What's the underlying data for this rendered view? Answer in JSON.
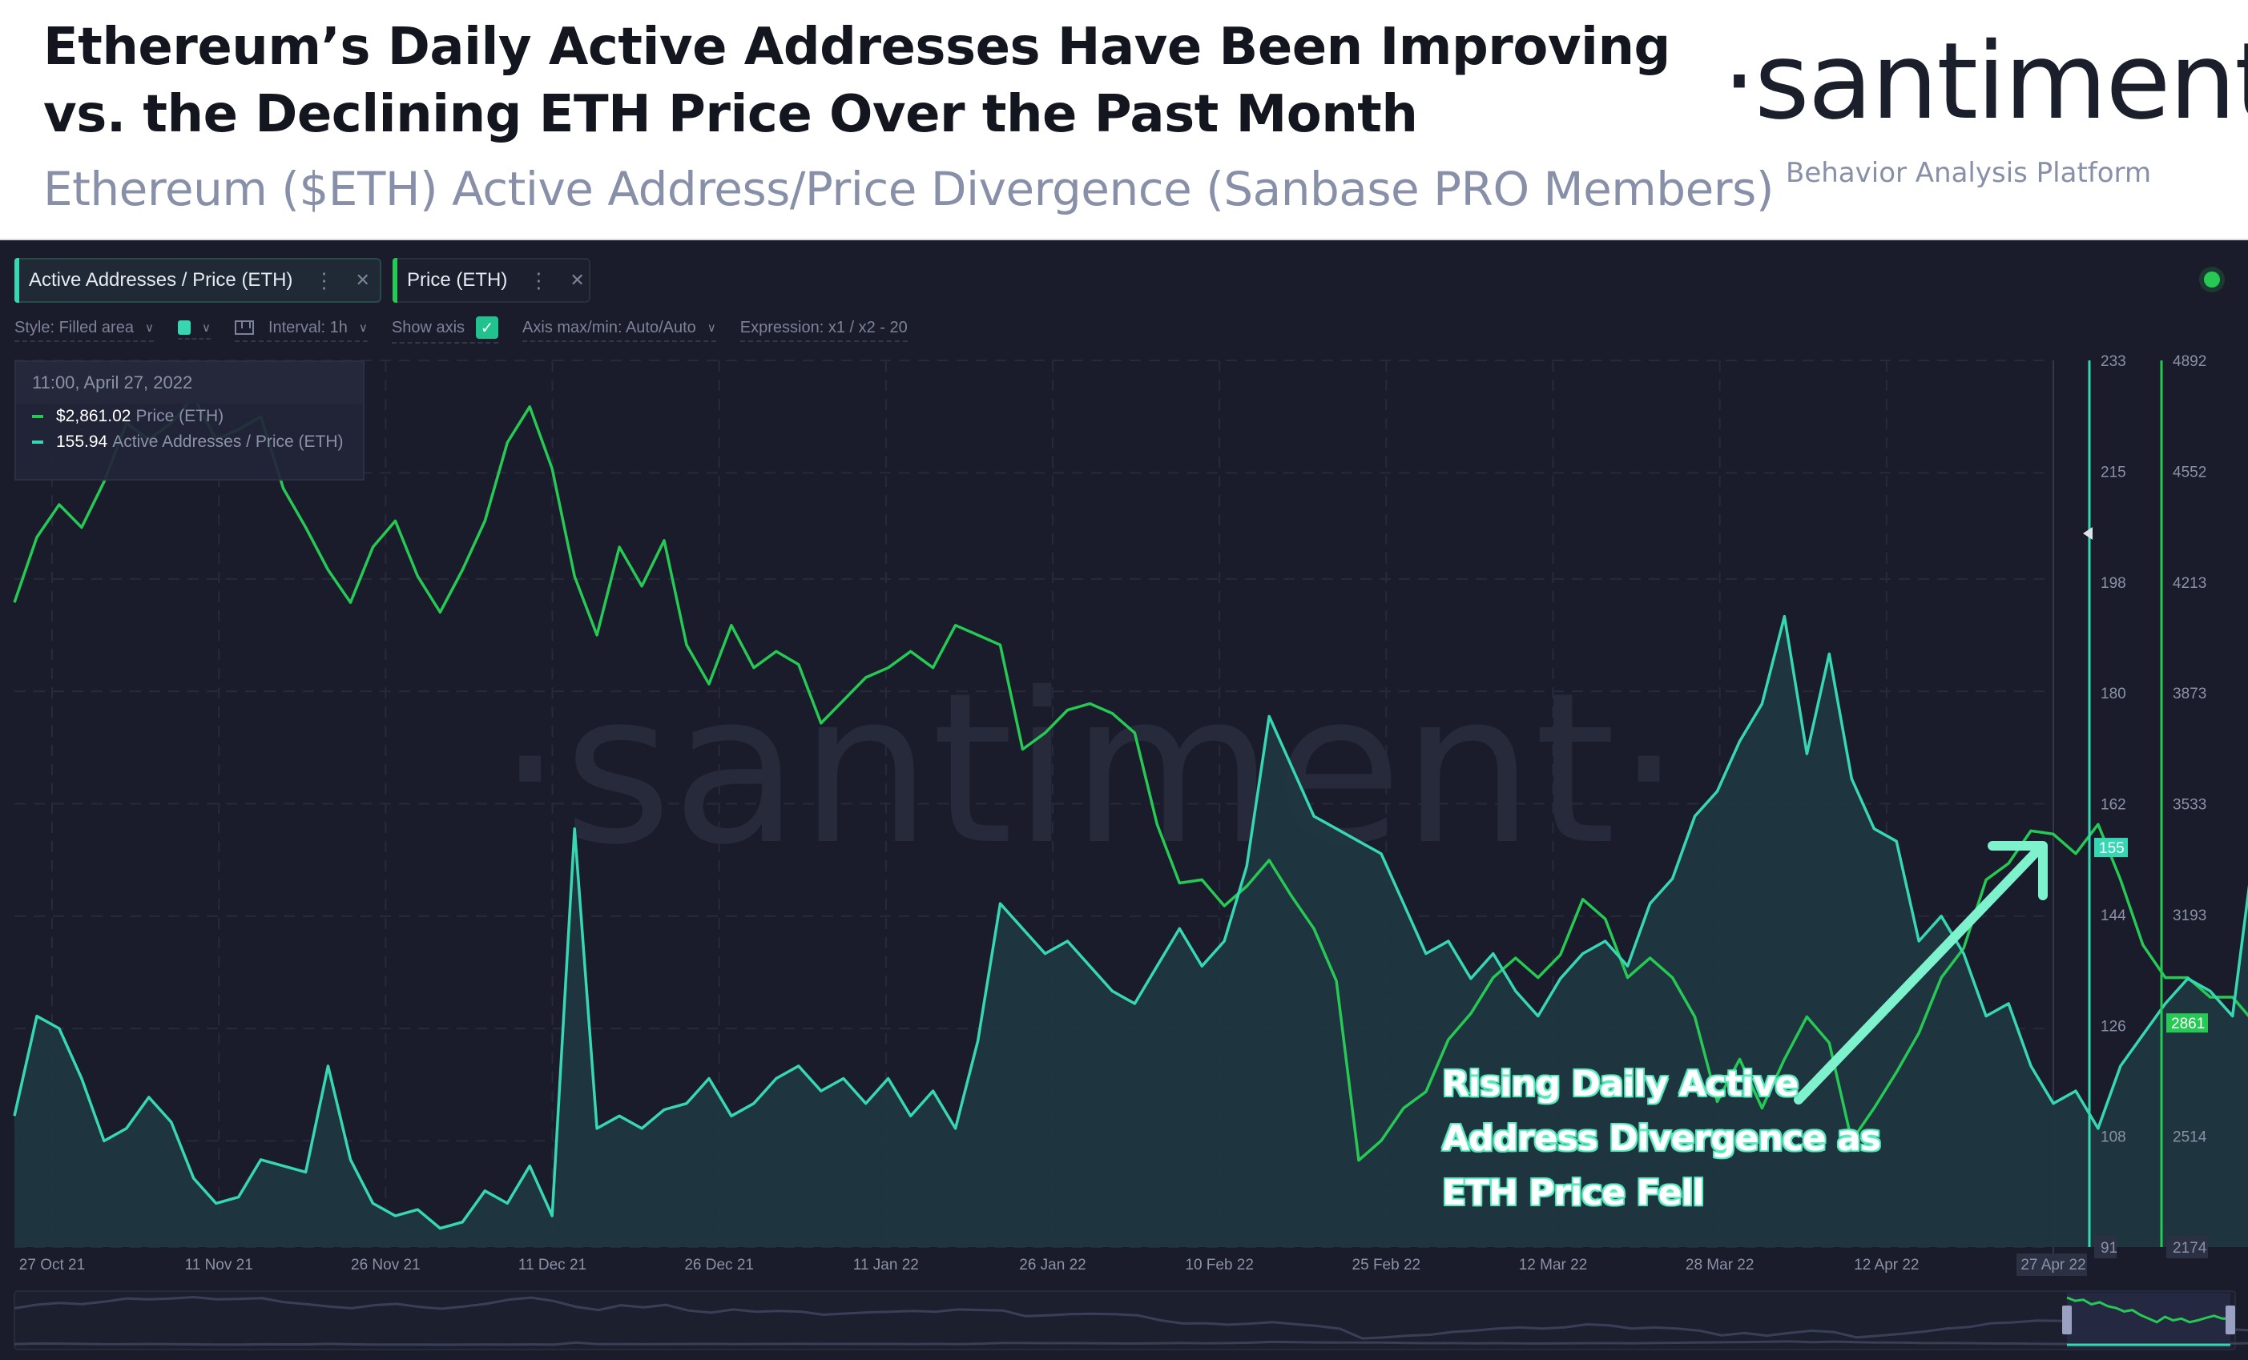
{
  "header": {
    "title_line1": "Ethereum’s Daily Active Addresses Have Been Improving",
    "title_line2": "vs. the Declining ETH Price Over the Past Month",
    "subtitle": "Ethereum ($ETH) Active Address/Price Divergence (Sanbase PRO Members)",
    "logo": "·santiment·",
    "logo_tagline": "Behavior Analysis Platform"
  },
  "tabs": [
    {
      "label": "Active Addresses / Price (ETH)",
      "menu_icon": "kebab-icon",
      "close_icon": "close-icon",
      "color": "#37d7b4"
    },
    {
      "label": "Price (ETH)",
      "menu_icon": "kebab-icon",
      "close_icon": "close-icon",
      "color": "#26c953"
    }
  ],
  "toolbar": {
    "style": "Style: Filled area",
    "color_swatch": "#37d7b4",
    "interval": "Interval: 1h",
    "show_axis": "Show axis",
    "show_axis_checked": true,
    "axis_maxmin": "Axis max/min: Auto/Auto",
    "expression": "Expression: x1 / x2 - 20"
  },
  "status": {
    "color": "#26c953"
  },
  "tooltip": {
    "datetime": "11:00, April 27, 2022",
    "rows": [
      {
        "value": "$2,861.02",
        "label": "Price (ETH)",
        "color": "#26c953"
      },
      {
        "value": "155.94",
        "label": "Active Addresses / Price (ETH)",
        "color": "#37d7b4"
      }
    ]
  },
  "watermark": "·santiment·",
  "annotation": {
    "lines": [
      "Rising Daily Active",
      "Address Divergence as",
      "ETH Price Fell"
    ],
    "color": "#7ef2cc"
  },
  "chart_data": {
    "type": "line",
    "title": "Ethereum’s Daily Active Addresses Have Been Improving vs. the Declining ETH Price Over the Past Month",
    "subtitle": "Ethereum ($ETH) Active Address/Price Divergence (Sanbase PRO Members)",
    "xlabel": "",
    "x_ticks": [
      "27 Oct 21",
      "11 Nov 21",
      "26 Nov 21",
      "11 Dec 21",
      "26 Dec 21",
      "11 Jan 22",
      "26 Jan 22",
      "10 Feb 22",
      "25 Feb 22",
      "12 Mar 22",
      "28 Mar 22",
      "12 Apr 22",
      "27 Apr 22"
    ],
    "x_range": [
      "2021-10-27",
      "2022-04-27"
    ],
    "grid": true,
    "legend": "top-left",
    "axes": [
      {
        "name": "Active Addresses / Price (ETH)",
        "side": "right",
        "ticks": [
          233,
          215,
          198,
          180,
          162,
          144,
          126,
          108,
          91
        ],
        "range": [
          91,
          233
        ],
        "current_value_label": "155",
        "color": "#37d7b4"
      },
      {
        "name": "Price (ETH)",
        "side": "right",
        "ticks": [
          4892,
          4552,
          4213,
          3873,
          3533,
          3193,
          2861,
          2514,
          2174
        ],
        "range": [
          2174,
          4892
        ],
        "current_value_label": "2861",
        "color": "#26c953"
      }
    ],
    "x": [
      0,
      2,
      4,
      6,
      8,
      10,
      12,
      14,
      16,
      18,
      20,
      22,
      24,
      26,
      28,
      30,
      32,
      34,
      36,
      38,
      40,
      42,
      44,
      46,
      48,
      50,
      52,
      54,
      56,
      58,
      60,
      62,
      64,
      66,
      68,
      70,
      72,
      74,
      76,
      78,
      80,
      82,
      84,
      86,
      88,
      90,
      92,
      94,
      96,
      98,
      100,
      102,
      104,
      106,
      108,
      110,
      112,
      114,
      116,
      118,
      120,
      122,
      124,
      126,
      128,
      130,
      132,
      134,
      136,
      138,
      140,
      142,
      144,
      146,
      148,
      150,
      152,
      154,
      156,
      158,
      160,
      162,
      164,
      166,
      168,
      170,
      172,
      174,
      176,
      178,
      180,
      182
    ],
    "x_unit": "days since 27 Oct 21",
    "series": [
      {
        "name": "Price (ETH)",
        "color": "#26c953",
        "axis": 1,
        "values": [
          4150,
          4350,
          4450,
          4380,
          4520,
          4700,
          4650,
          4700,
          4780,
          4650,
          4680,
          4720,
          4500,
          4380,
          4250,
          4150,
          4320,
          4400,
          4230,
          4120,
          4250,
          4400,
          4640,
          4750,
          4560,
          4230,
          4050,
          4320,
          4200,
          4340,
          4020,
          3900,
          4080,
          3950,
          4000,
          3960,
          3780,
          3850,
          3920,
          3950,
          4000,
          3950,
          4080,
          4050,
          4020,
          3700,
          3750,
          3820,
          3840,
          3810,
          3750,
          3470,
          3290,
          3300,
          3220,
          3280,
          3360,
          3250,
          3150,
          2990,
          2440,
          2500,
          2600,
          2650,
          2810,
          2890,
          3000,
          3060,
          3000,
          3070,
          3240,
          3180,
          3000,
          3060,
          3000,
          2880,
          2620,
          2750,
          2600,
          2750,
          2880,
          2800,
          2500,
          2600,
          2710,
          2830,
          3000,
          3090,
          3300,
          3350,
          3450,
          3440,
          3380,
          3470,
          3300,
          3100,
          3000,
          3000,
          2940,
          2940,
          2860
        ],
        "sampling": "approx every 2 days (values estimated from chart)"
      },
      {
        "name": "Active Addresses / Price (ETH)",
        "color": "#37d7b4",
        "axis": 0,
        "values": [
          112,
          128,
          126,
          118,
          108,
          110,
          115,
          111,
          102,
          98,
          99,
          105,
          104,
          103,
          120,
          105,
          98,
          96,
          97,
          94,
          95,
          100,
          98,
          104,
          96,
          158,
          110,
          112,
          110,
          113,
          114,
          118,
          112,
          114,
          118,
          120,
          116,
          118,
          114,
          118,
          112,
          116,
          110,
          124,
          146,
          142,
          138,
          140,
          136,
          132,
          130,
          136,
          142,
          136,
          140,
          152,
          176,
          168,
          160,
          158,
          156,
          154,
          146,
          138,
          140,
          134,
          138,
          132,
          128,
          134,
          138,
          140,
          136,
          146,
          150,
          160,
          164,
          172,
          178,
          192,
          170,
          186,
          166,
          158,
          156,
          140,
          144,
          138,
          128,
          130,
          120,
          114,
          116,
          110,
          120,
          125,
          130,
          134,
          132,
          128,
          156
        ],
        "sampling": "approx every 2 days (values estimated from chart)"
      }
    ]
  }
}
